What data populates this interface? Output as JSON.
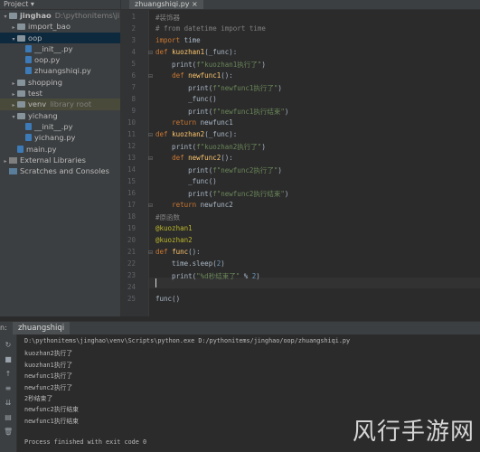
{
  "project_panel": {
    "header": "Project ▾",
    "items": [
      {
        "label": "jinghao",
        "extra": "D:\\pythonitems\\jinghao",
        "depth": 0,
        "arrow": "▾",
        "type": "folder",
        "bold": true
      },
      {
        "label": "import_bao",
        "depth": 1,
        "arrow": "▸",
        "type": "folder"
      },
      {
        "label": "oop",
        "depth": 1,
        "arrow": "▾",
        "type": "folder",
        "selected": true
      },
      {
        "label": "__init__.py",
        "depth": 2,
        "arrow": "",
        "type": "py"
      },
      {
        "label": "oop.py",
        "depth": 2,
        "arrow": "",
        "type": "py"
      },
      {
        "label": "zhuangshiqi.py",
        "depth": 2,
        "arrow": "",
        "type": "py"
      },
      {
        "label": "shopping",
        "depth": 1,
        "arrow": "▸",
        "type": "folder"
      },
      {
        "label": "test",
        "depth": 1,
        "arrow": "▸",
        "type": "folder"
      },
      {
        "label": "venv",
        "extra": "library root",
        "depth": 1,
        "arrow": "▸",
        "type": "folder",
        "venv": true
      },
      {
        "label": "yichang",
        "depth": 1,
        "arrow": "▾",
        "type": "folder"
      },
      {
        "label": "__init__.py",
        "depth": 2,
        "arrow": "",
        "type": "py"
      },
      {
        "label": "yichang.py",
        "depth": 2,
        "arrow": "",
        "type": "py"
      },
      {
        "label": "main.py",
        "depth": 1,
        "arrow": "",
        "type": "py"
      },
      {
        "label": "External Libraries",
        "depth": 0,
        "arrow": "▸",
        "type": "lib"
      },
      {
        "label": "Scratches and Consoles",
        "depth": 0,
        "arrow": "",
        "type": "scr"
      }
    ]
  },
  "editor": {
    "tab_label": "zhuangshiqi.py ×",
    "lines": [
      {
        "n": "1",
        "html": "<span class=\"cm\">#装饰器</span>"
      },
      {
        "n": "2",
        "html": "<span class=\"cm\"># from datetime import time</span>"
      },
      {
        "n": "3",
        "html": "<span class=\"kw\">import</span> time"
      },
      {
        "n": "4",
        "html": "<span class=\"kw\">def</span> <span class=\"fn\">kuozhan1</span>(_func):"
      },
      {
        "n": "5",
        "html": "    print(<span class=\"st\">f\"kuozhan1执行了\"</span>)"
      },
      {
        "n": "6",
        "html": "    <span class=\"kw\">def</span> <span class=\"fn\">newfunc1</span>():"
      },
      {
        "n": "7",
        "html": "        print(<span class=\"st\">f\"newfunc1执行了\"</span>)"
      },
      {
        "n": "8",
        "html": "        _func()"
      },
      {
        "n": "9",
        "html": "        print(<span class=\"st\">f\"newfunc1执行结束\"</span>)"
      },
      {
        "n": "10",
        "html": "    <span class=\"kw\">return</span> newfunc1"
      },
      {
        "n": "11",
        "html": "<span class=\"kw\">def</span> <span class=\"fn\">kuozhan2</span>(_func):"
      },
      {
        "n": "12",
        "html": "    print(<span class=\"st\">f\"kuozhan2执行了\"</span>)"
      },
      {
        "n": "13",
        "html": "    <span class=\"kw\">def</span> <span class=\"fn\">newfunc2</span>():"
      },
      {
        "n": "14",
        "html": "        print(<span class=\"st\">f\"newfunc2执行了\"</span>)"
      },
      {
        "n": "15",
        "html": "        _func()"
      },
      {
        "n": "16",
        "html": "        print(<span class=\"st\">f\"newfunc2执行结束\"</span>)"
      },
      {
        "n": "17",
        "html": "    <span class=\"kw\">return</span> newfunc2"
      },
      {
        "n": "18",
        "html": "<span class=\"cm\">#原函数</span>"
      },
      {
        "n": "19",
        "html": "<span class=\"dec\">@kuozhan1</span>"
      },
      {
        "n": "20",
        "html": "<span class=\"dec\">@kuozhan2</span>"
      },
      {
        "n": "21",
        "html": "<span class=\"kw\">def</span> <span class=\"fn\">func</span>():"
      },
      {
        "n": "22",
        "html": "    time.sleep(<span class=\"num\">2</span>)"
      },
      {
        "n": "23",
        "html": "    print(<span class=\"st\">\"%d秒结束了\"</span> % <span class=\"num\">2</span>)"
      },
      {
        "n": "24",
        "html": ""
      },
      {
        "n": "25",
        "html": "func()"
      }
    ]
  },
  "run_panel": {
    "label": "n:",
    "tab_label": "zhuangshiqi",
    "output": [
      "D:\\pythonitems\\jinghao\\venv\\Scripts\\python.exe D:/pythonitems/jinghao/oop/zhuangshiqi.py",
      "kuozhan2执行了",
      "kuozhan1执行了",
      "newfunc1执行了",
      "newfunc2执行了",
      "2秒结束了",
      "newfunc2执行结束",
      "newfunc1执行结束",
      "",
      "Process finished with exit code 0"
    ]
  },
  "watermark": "风行手游网"
}
